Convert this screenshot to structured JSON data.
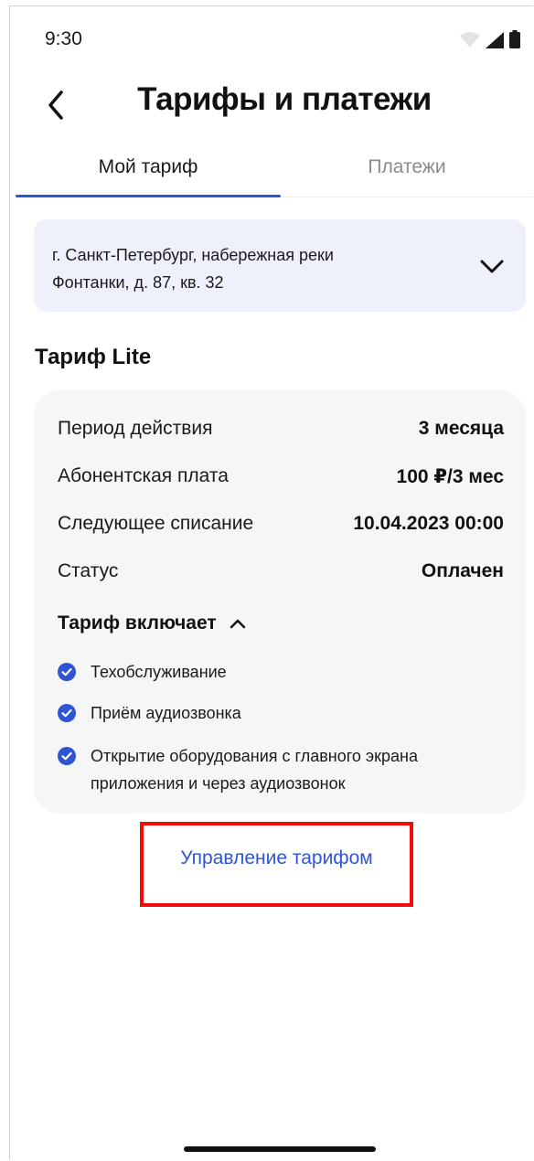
{
  "status_bar": {
    "time": "9:30"
  },
  "header": {
    "title": "Тарифы и платежи",
    "back_icon": "chevron-left-icon"
  },
  "tabs": [
    {
      "label": "Мой тариф",
      "active": true
    },
    {
      "label": "Платежи",
      "active": false
    }
  ],
  "address": {
    "line1": "г. Санкт-Петербург, набережная реки",
    "line2": "Фонтанки, д. 87, кв. 32"
  },
  "tariff": {
    "title": "Тариф Lite",
    "details": [
      {
        "label": "Период действия",
        "value": "3 месяца"
      },
      {
        "label": "Абонентская плата",
        "value": "100 ₽/3 мес"
      },
      {
        "label": "Следующее списание",
        "value": "10.04.2023 00:00"
      },
      {
        "label": "Статус",
        "value": "Оплачен"
      }
    ],
    "includes_label": "Тариф включает",
    "features": [
      {
        "line1": "Техобслуживание",
        "line2": ""
      },
      {
        "line1": "Приём аудиозвонка",
        "line2": ""
      },
      {
        "line1": "Открытие оборудования с главного экрана",
        "line2": "приложения и через аудиозвонок"
      }
    ]
  },
  "manage_link": "Управление тарифом",
  "colors": {
    "accent": "#2f55d4",
    "address_bg": "#eef1fb",
    "card_bg": "#f6f6f6",
    "highlight": "#f20c0c"
  }
}
